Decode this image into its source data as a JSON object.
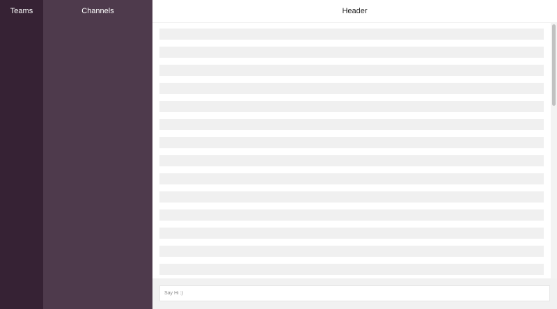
{
  "sidebar": {
    "teams_title": "Teams",
    "channels_title": "Channels"
  },
  "header": {
    "title": "Header"
  },
  "messages": {
    "row_count": 14
  },
  "composer": {
    "placeholder": "Say Hi :)",
    "value": ""
  },
  "colors": {
    "teams_bg": "#362234",
    "channels_bg": "#4e3a4c",
    "message_row": "#f0f0f0",
    "input_area_bg": "#f1f1f1"
  }
}
